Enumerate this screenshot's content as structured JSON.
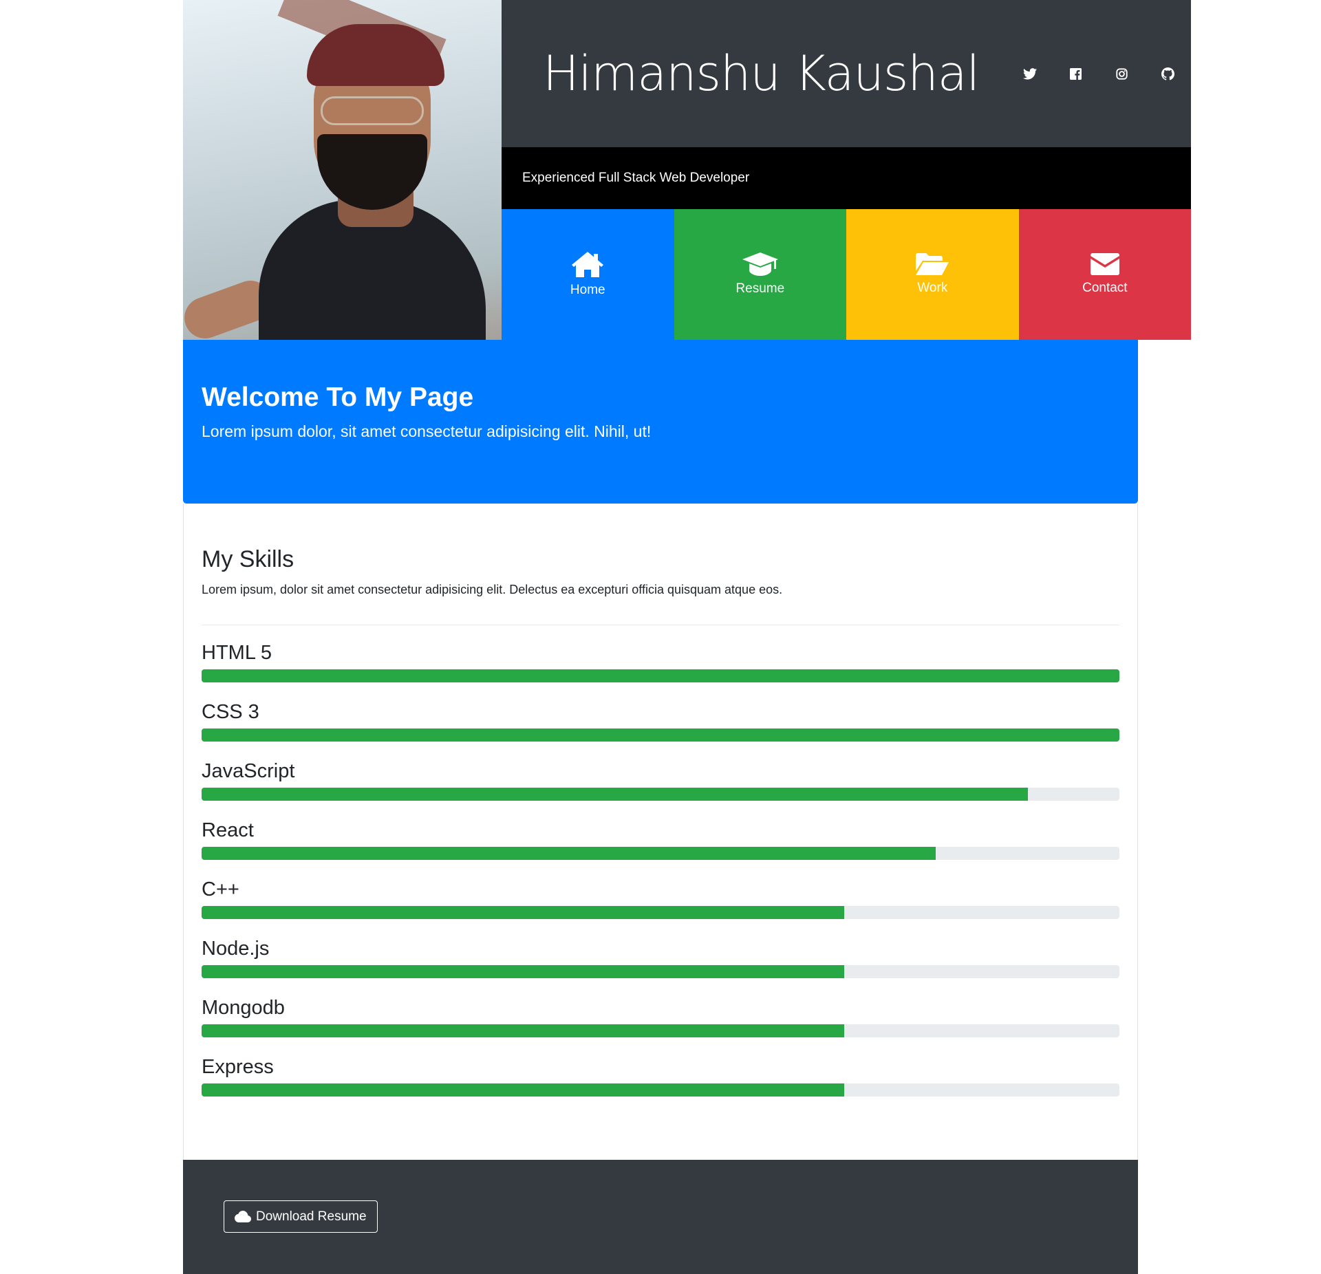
{
  "header": {
    "name": "Himanshu Kaushal",
    "tagline": "Experienced Full Stack Web Developer",
    "socials": [
      "twitter-icon",
      "facebook-icon",
      "instagram-icon",
      "github-icon"
    ]
  },
  "nav": [
    {
      "label": "Home",
      "icon": "home-icon",
      "color": "#007bff"
    },
    {
      "label": "Resume",
      "icon": "graduation-cap-icon",
      "color": "#28a745"
    },
    {
      "label": "Work",
      "icon": "folder-open-icon",
      "color": "#ffc107"
    },
    {
      "label": "Contact",
      "icon": "envelope-icon",
      "color": "#dc3545"
    }
  ],
  "welcome": {
    "title": "Welcome To My Page",
    "text": "Lorem ipsum dolor, sit amet consectetur adipisicing elit. Nihil, ut!"
  },
  "skills": {
    "title": "My Skills",
    "description": "Lorem ipsum, dolor sit amet consectetur adipisicing elit. Delectus ea excepturi officia quisquam atque eos.",
    "items": [
      {
        "name": "HTML 5",
        "percent": 100
      },
      {
        "name": "CSS 3",
        "percent": 100
      },
      {
        "name": "JavaScript",
        "percent": 90
      },
      {
        "name": "React",
        "percent": 80
      },
      {
        "name": "C++",
        "percent": 70
      },
      {
        "name": "Node.js",
        "percent": 70
      },
      {
        "name": "Mongodb",
        "percent": 70
      },
      {
        "name": "Express",
        "percent": 70
      }
    ],
    "bar_color": "#28a745"
  },
  "footer": {
    "download_label": "Download Resume",
    "download_icon": "cloud-icon"
  }
}
